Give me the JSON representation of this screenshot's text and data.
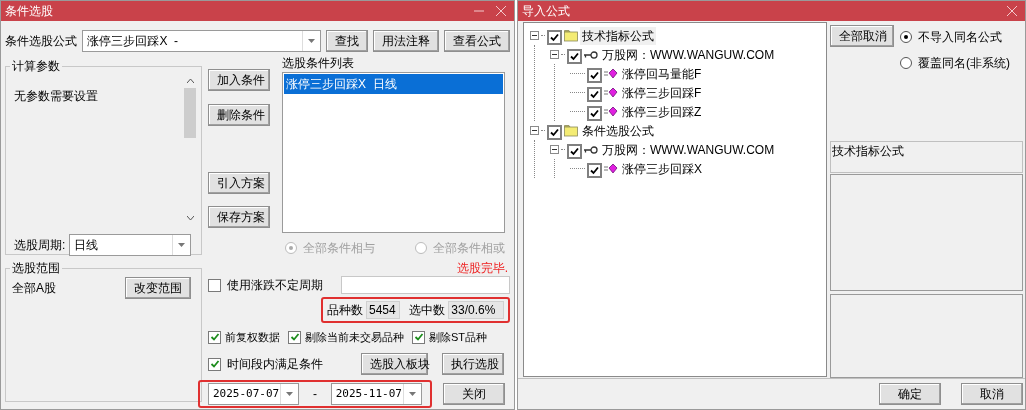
{
  "left_window": {
    "title": "条件选股",
    "formula": {
      "label": "条件选股公式",
      "value": "涨停三步回踩X  -"
    },
    "top_buttons": [
      "查找",
      "用法注释",
      "查看公式"
    ],
    "params_group": {
      "title": "计算参数",
      "text": "无参数需要设置"
    },
    "period": {
      "label": "选股周期:",
      "value": "日线"
    },
    "range_group": {
      "title": "选股范围",
      "text": "全部A股",
      "button": "改变范围"
    },
    "side_buttons": [
      "加入条件",
      "删除条件",
      "引入方案",
      "保存方案"
    ],
    "condition_list": {
      "title": "选股条件列表",
      "items": [
        {
          "label": "涨停三步回踩X  日线",
          "selected": true
        }
      ]
    },
    "logic_radios": [
      {
        "label": "全部条件相与",
        "selected": true,
        "disabled": true
      },
      {
        "label": "全部条件相或",
        "selected": false,
        "disabled": true
      }
    ],
    "status": "选股完毕.",
    "variable_period": {
      "label": "使用涨跌不定周期",
      "checked": false
    },
    "counts": [
      {
        "label": "品种数",
        "value": "5454"
      },
      {
        "label": "选中数",
        "value": "33/0.6%"
      }
    ],
    "options": [
      {
        "label": "前复权数据",
        "checked": true
      },
      {
        "label": "剔除当前未交易品种",
        "checked": true
      },
      {
        "label": "剔除ST品种",
        "checked": true
      }
    ],
    "time_filter": {
      "label": "时间段内满足条件",
      "checked": true
    },
    "date_from": "2025-07-07",
    "date_separator": "-",
    "date_to": "2025-11-07",
    "action_buttons": [
      "选股入板块",
      "执行选股",
      "关闭"
    ]
  },
  "right_window": {
    "title": "导入公式",
    "tree": [
      {
        "label": "技术指标公式",
        "kind": "folder",
        "checked": true,
        "expanded": true,
        "selected": true,
        "children": [
          {
            "label": "万股网：WWW.WANGUW.COM",
            "kind": "key",
            "checked": true,
            "expanded": true,
            "selected": false,
            "children": [
              {
                "label": "涨停回马量能F",
                "kind": "formula",
                "checked": true,
                "selected": false
              },
              {
                "label": "涨停三步回踩F",
                "kind": "formula",
                "checked": true,
                "selected": false
              },
              {
                "label": "涨停三步回踩Z",
                "kind": "formula",
                "checked": true,
                "selected": false
              }
            ]
          }
        ]
      },
      {
        "label": "条件选股公式",
        "kind": "folder",
        "checked": true,
        "expanded": true,
        "selected": false,
        "children": [
          {
            "label": "万股网：WWW.WANGUW.COM",
            "kind": "key",
            "checked": true,
            "expanded": true,
            "selected": false,
            "children": [
              {
                "label": "涨停三步回踩X",
                "kind": "formula",
                "checked": true,
                "selected": false
              }
            ]
          }
        ]
      }
    ],
    "cancel_all": "全部取消",
    "import_radios": [
      {
        "label": "不导入同名公式",
        "selected": true
      },
      {
        "label": "覆盖同名(非系统)",
        "selected": false
      }
    ],
    "info": "技术指标公式",
    "buttons": [
      "确定",
      "取消"
    ]
  }
}
